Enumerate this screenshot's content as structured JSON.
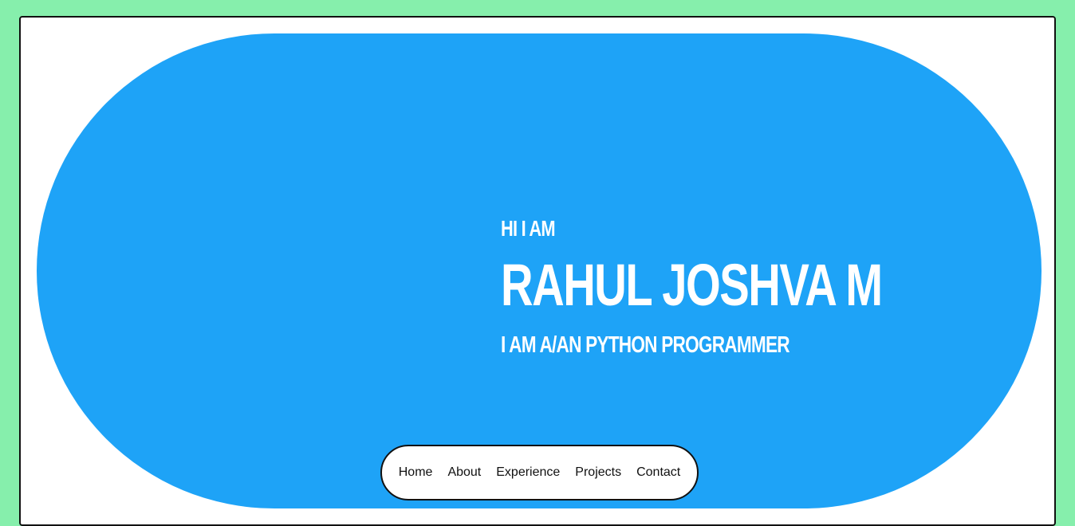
{
  "hero": {
    "greeting": "HI I AM",
    "name": "RAHUL JOSHVA M",
    "role": "I AM A/AN PYTHON PROGRAMMER"
  },
  "nav": {
    "items": [
      {
        "label": "Home"
      },
      {
        "label": "About"
      },
      {
        "label": "Experience"
      },
      {
        "label": "Projects"
      },
      {
        "label": "Contact"
      }
    ]
  },
  "colors": {
    "page_background": "#86efac",
    "hero_background": "#1ea3f7",
    "hero_text": "#ffffff",
    "nav_background": "#ffffff"
  }
}
